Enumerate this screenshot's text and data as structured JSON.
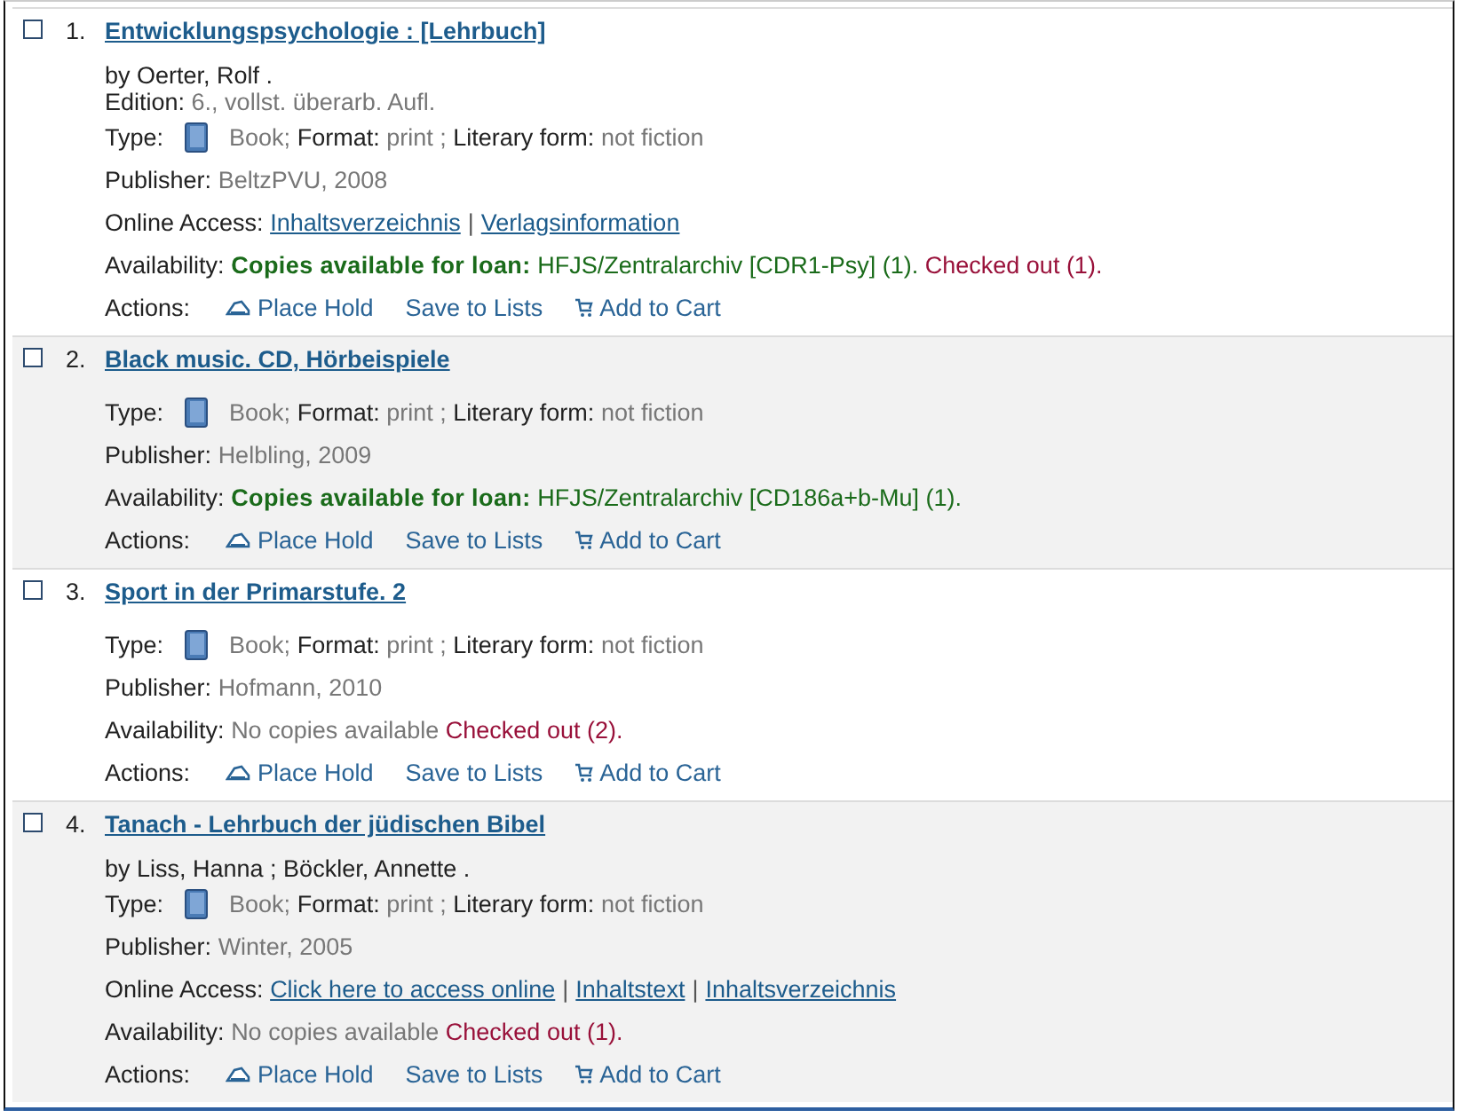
{
  "records": [
    {
      "number": "1.",
      "title": "Entwicklungspsychologie : [Lehrbuch]",
      "checked": false,
      "lines": [
        {
          "kind": "author",
          "text": "by Oerter, Rolf ."
        },
        {
          "kind": "edition",
          "label": "Edition:",
          "value": "6., vollst. überarb. Aufl."
        },
        {
          "kind": "type",
          "label": "Type:",
          "value": "Book;",
          "format_label": "Format:",
          "format": "print ;",
          "form_label": "Literary form:",
          "form": "not fiction"
        },
        {
          "kind": "plain",
          "label": "Publisher:",
          "value": "BeltzPVU, 2008"
        },
        {
          "kind": "links",
          "label": "Online Access:",
          "separator": "|",
          "links": [
            "Inhaltsverzeichnis",
            "Verlagsinformation"
          ]
        },
        {
          "kind": "availability",
          "label": "Availability:",
          "available": "Copies available for loan:",
          "location": "HFJS/Zentralarchiv [CDR1-Psy] (1).",
          "checked_out": "Checked out (1)."
        },
        {
          "kind": "actions",
          "label": "Actions:",
          "items": [
            {
              "kind": "hold",
              "label": "Place Hold"
            },
            {
              "kind": "list",
              "label": "Save to Lists"
            },
            {
              "kind": "cart",
              "label": "Add to Cart"
            }
          ]
        }
      ]
    },
    {
      "number": "2.",
      "title": "Black music. CD, Hörbeispiele",
      "checked": false,
      "lines": [
        {
          "kind": "type",
          "label": "Type:",
          "value": "Book;",
          "format_label": "Format:",
          "format": "print ;",
          "form_label": "Literary form:",
          "form": "not fiction"
        },
        {
          "kind": "plain",
          "label": "Publisher:",
          "value": "Helbling, 2009"
        },
        {
          "kind": "availability",
          "label": "Availability:",
          "available": "Copies available for loan:",
          "location": "HFJS/Zentralarchiv [CD186a+b-Mu] (1)."
        },
        {
          "kind": "actions",
          "label": "Actions:",
          "items": [
            {
              "kind": "hold",
              "label": "Place Hold"
            },
            {
              "kind": "list",
              "label": "Save to Lists"
            },
            {
              "kind": "cart",
              "label": "Add to Cart"
            }
          ]
        }
      ]
    },
    {
      "number": "3.",
      "title": "Sport in der Primarstufe. 2",
      "checked": false,
      "lines": [
        {
          "kind": "type",
          "label": "Type:",
          "value": "Book;",
          "format_label": "Format:",
          "format": "print ;",
          "form_label": "Literary form:",
          "form": "not fiction"
        },
        {
          "kind": "plain",
          "label": "Publisher:",
          "value": "Hofmann, 2010"
        },
        {
          "kind": "availability",
          "label": "Availability:",
          "none": "No copies available",
          "checked_out": "Checked out (2)."
        },
        {
          "kind": "actions",
          "label": "Actions:",
          "items": [
            {
              "kind": "hold",
              "label": "Place Hold"
            },
            {
              "kind": "list",
              "label": "Save to Lists"
            },
            {
              "kind": "cart",
              "label": "Add to Cart"
            }
          ]
        }
      ]
    },
    {
      "number": "4.",
      "title": "Tanach - Lehrbuch der jüdischen Bibel",
      "checked": false,
      "lines": [
        {
          "kind": "author",
          "text": "by Liss, Hanna ; Böckler, Annette ."
        },
        {
          "kind": "type",
          "label": "Type:",
          "value": "Book;",
          "format_label": "Format:",
          "format": "print ;",
          "form_label": "Literary form:",
          "form": "not fiction"
        },
        {
          "kind": "plain",
          "label": "Publisher:",
          "value": "Winter, 2005"
        },
        {
          "kind": "links",
          "label": "Online Access:",
          "separator": "|",
          "links": [
            "Click here to access online",
            "Inhaltstext",
            "Inhaltsverzeichnis"
          ]
        },
        {
          "kind": "availability",
          "label": "Availability:",
          "none": "No copies available",
          "checked_out": "Checked out (1)."
        },
        {
          "kind": "actions",
          "label": "Actions:",
          "items": [
            {
              "kind": "hold",
              "label": "Place Hold"
            },
            {
              "kind": "list",
              "label": "Save to Lists"
            },
            {
              "kind": "cart",
              "label": "Add to Cart"
            }
          ]
        }
      ]
    }
  ]
}
